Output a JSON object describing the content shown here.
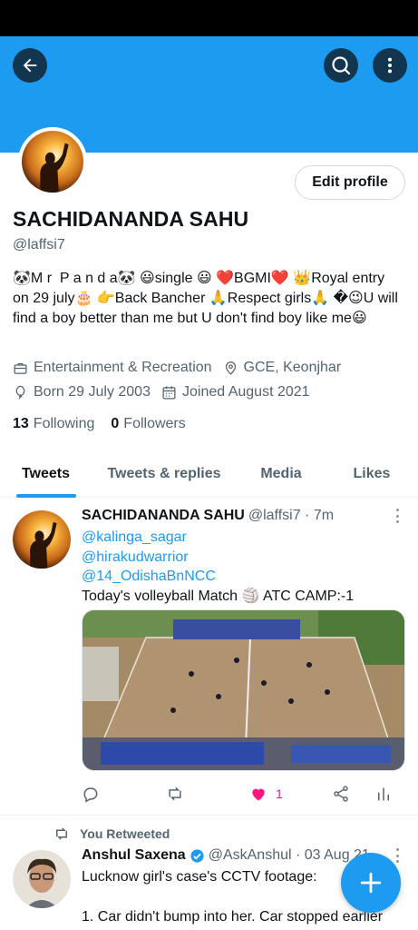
{
  "header": {
    "back_icon": "arrow-left-icon",
    "search_icon": "search-icon",
    "more_icon": "more-vertical-icon",
    "banner_color": "#1d9bf0"
  },
  "profile": {
    "edit_button": "Edit profile",
    "name": "SACHIDANANDA SAHU",
    "handle": "@laffsi7",
    "bio": "🐼M r  P a n d a🐼 😃single 😃 ❤️BGMI❤️ 👑Royal entry on 29 july🎂 👉Back Bancher 🙏Respect girls🙏 �😉U will find a boy better than me but U don't find boy like me😃",
    "category": "Entertainment & Recreation",
    "location": "GCE, Keonjhar",
    "born": "Born 29 July 2003",
    "joined": "Joined August 2021",
    "following_count": "13",
    "following_label": "Following",
    "followers_count": "0",
    "followers_label": "Followers"
  },
  "tabs": [
    {
      "label": "Tweets",
      "active": true
    },
    {
      "label": "Tweets & replies",
      "active": false
    },
    {
      "label": "Media",
      "active": false
    },
    {
      "label": "Likes",
      "active": false
    }
  ],
  "tweets": [
    {
      "name": "SACHIDANANDA SAHU",
      "handle_time": "@laffsi7 · 7m",
      "mentions": [
        "@kalinga_sagar",
        "@hirakudwarrior",
        "@14_OdishaBnNCC"
      ],
      "text": "Today's volleyball Match 🏐 ATC CAMP:-1",
      "like_count": "1",
      "liked": true
    },
    {
      "retweet_label": "You Retweeted",
      "name": "Anshul Saxena",
      "handle_time": "@AskAnshul · 03 Aug 21",
      "text_line1": "Lucknow girl's case's CCTV footage:",
      "text_line2": "1. Car didn't bump into her. Car stopped earlier"
    }
  ],
  "fab": {
    "icon": "plus-icon"
  },
  "colors": {
    "accent": "#1d9bf0",
    "like": "#f91880",
    "text": "#0f1419",
    "secondary": "#536471"
  }
}
